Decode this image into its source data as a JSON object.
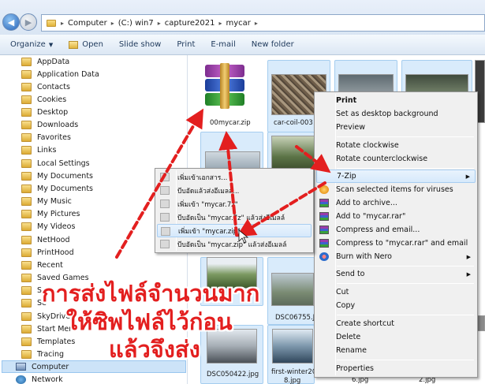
{
  "address_bar": {
    "crumbs": [
      "Computer",
      "(C:) win7",
      "capture2021",
      "mycar"
    ]
  },
  "toolbar": {
    "organize": "Organize",
    "open": "Open",
    "slide_show": "Slide show",
    "print": "Print",
    "email": "E-mail",
    "new_folder": "New folder"
  },
  "nav_pane": {
    "items": [
      "AppData",
      "Application Data",
      "Contacts",
      "Cookies",
      "Desktop",
      "Downloads",
      "Favorites",
      "Links",
      "Local Settings",
      "My Documents",
      "My Documents",
      "My Music",
      "My Pictures",
      "My Videos",
      "NetHood",
      "PrintHood",
      "Recent",
      "Saved Games",
      "Se",
      "Se",
      "SkyDrive",
      "Start Men",
      "Templates",
      "Tracing"
    ],
    "computer": "Computer",
    "network": "Network"
  },
  "files": {
    "zip_name": "00mycar.zip",
    "car_coil": "car-coil-003",
    "dsc06755": "DSC06755.J",
    "dsc050422": "DSC050422.jpg",
    "first_winter": "first-winter20",
    "first_winter_ext": "8.jpg",
    "jpg_a": "6.jpg",
    "jpg_b": "2.jpg"
  },
  "context_menu": {
    "print": "Print",
    "set_bg": "Set as desktop background",
    "preview": "Preview",
    "rotate_cw": "Rotate clockwise",
    "rotate_ccw": "Rotate counterclockwise",
    "seven_zip": "7-Zip",
    "scan": "Scan selected items for viruses",
    "add_archive": "Add to archive...",
    "add_rar": "Add to \"mycar.rar\"",
    "compress_email": "Compress and email...",
    "compress_rar_email": "Compress to \"mycar.rar\" and email",
    "burn_nero": "Burn with Nero",
    "send_to": "Send to",
    "cut": "Cut",
    "copy": "Copy",
    "create_shortcut": "Create shortcut",
    "delete": "Delete",
    "rename": "Rename",
    "properties": "Properties"
  },
  "submenu": {
    "items": [
      "เพิ่มเข้าเอกสาร...",
      "บีบอัดแล้วส่งอีเมลล์...",
      "เพิ่มเข้า \"mycar.7z\"",
      "บีบอัดเป็น \"mycar.7z\" แล้วส่งอีเมลล์",
      "เพิ่มเข้า \"mycar.zip\"",
      "บีบอัดเป็น \"mycar.zip\" แล้วส่งอีเมลล์"
    ]
  },
  "caption": {
    "line1": "การส่งไฟล์จำนวนมาก",
    "line2": "ให้ซิพไฟล์ไว้ก่อน",
    "line3": "แล้วจึงส่ง"
  },
  "colors": {
    "caption": "#e31f1f",
    "arrow": "#e31f1f",
    "menu_bg": "#f0f0f0",
    "selection": "#d9ebfb"
  }
}
